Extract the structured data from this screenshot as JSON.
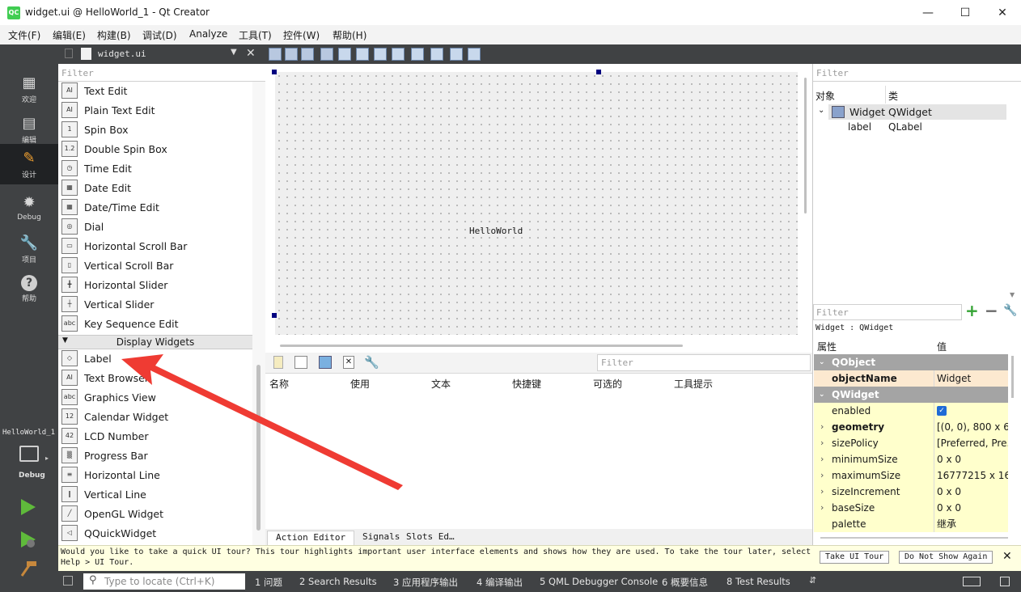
{
  "window": {
    "title": "widget.ui @ HelloWorld_1 - Qt Creator",
    "app_icon": "QC"
  },
  "menu": [
    "文件(F)",
    "编辑(E)",
    "构建(B)",
    "调试(D)",
    "Analyze",
    "工具(T)",
    "控件(W)",
    "帮助(H)"
  ],
  "modes": [
    {
      "label": "欢迎",
      "icon": "grid-icon"
    },
    {
      "label": "编辑",
      "icon": "edit-doc-icon"
    },
    {
      "label": "设计",
      "icon": "pencil-icon"
    },
    {
      "label": "Debug",
      "icon": "bug-icon"
    },
    {
      "label": "项目",
      "icon": "wrench-icon"
    },
    {
      "label": "帮助",
      "icon": "help-icon"
    }
  ],
  "kit": {
    "project": "HelloWorld_1",
    "config": "Debug"
  },
  "editor_tab": {
    "file": "widget.ui"
  },
  "widget_box": {
    "filter_placeholder": "Filter",
    "items_input": [
      {
        "label": "Text Edit",
        "icon": "AI"
      },
      {
        "label": "Plain Text Edit",
        "icon": "AI"
      },
      {
        "label": "Spin Box",
        "icon": "1"
      },
      {
        "label": "Double Spin Box",
        "icon": "1.2"
      },
      {
        "label": "Time Edit",
        "icon": "clock"
      },
      {
        "label": "Date Edit",
        "icon": "cal"
      },
      {
        "label": "Date/Time Edit",
        "icon": "cal"
      },
      {
        "label": "Dial",
        "icon": "dial"
      },
      {
        "label": "Horizontal Scroll Bar",
        "icon": "hsb"
      },
      {
        "label": "Vertical Scroll Bar",
        "icon": "vsb"
      },
      {
        "label": "Horizontal Slider",
        "icon": "hsl"
      },
      {
        "label": "Vertical Slider",
        "icon": "vsl"
      },
      {
        "label": "Key Sequence Edit",
        "icon": "ABC"
      }
    ],
    "category": "Display Widgets",
    "items_display": [
      {
        "label": "Label",
        "icon": "tag"
      },
      {
        "label": "Text Browser",
        "icon": "AI"
      },
      {
        "label": "Graphics View",
        "icon": "abc"
      },
      {
        "label": "Calendar Widget",
        "icon": "12"
      },
      {
        "label": "LCD Number",
        "icon": "42"
      },
      {
        "label": "Progress Bar",
        "icon": "prog"
      },
      {
        "label": "Horizontal Line",
        "icon": "hline"
      },
      {
        "label": "Vertical Line",
        "icon": "vline"
      },
      {
        "label": "OpenGL Widget",
        "icon": "gl"
      },
      {
        "label": "QQuickWidget",
        "icon": "qq"
      }
    ]
  },
  "form": {
    "label_text": "HelloWorld"
  },
  "action_editor": {
    "filter_placeholder": "Filter",
    "columns": [
      "名称",
      "使用",
      "文本",
      "快捷键",
      "可选的",
      "工具提示"
    ],
    "tabs": [
      "Action Editor",
      "Signals",
      "Slots Ed…"
    ]
  },
  "object_inspector": {
    "filter_placeholder": "Filter",
    "headers": [
      "对象",
      "类"
    ],
    "rows": [
      {
        "object": "Widget",
        "class": "QWidget"
      },
      {
        "object": "label",
        "class": "QLabel"
      }
    ]
  },
  "property_editor": {
    "filter_placeholder": "Filter",
    "context": "Widget : QWidget",
    "headers": [
      "属性",
      "值"
    ],
    "rows": [
      {
        "name": "QObject",
        "value": "",
        "kind": "cat"
      },
      {
        "name": "objectName",
        "value": "Widget",
        "kind": "org"
      },
      {
        "name": "QWidget",
        "value": "",
        "kind": "cat"
      },
      {
        "name": "enabled",
        "value": "",
        "kind": "ylw"
      },
      {
        "name": "geometry",
        "value": "[(0, 0), 800 x 6...",
        "kind": "ylw"
      },
      {
        "name": "sizePolicy",
        "value": "[Preferred, Pre...",
        "kind": "ylw"
      },
      {
        "name": "minimumSize",
        "value": "0 x 0",
        "kind": "ylw"
      },
      {
        "name": "maximumSize",
        "value": "16777215 x 16...",
        "kind": "ylw"
      },
      {
        "name": "sizeIncrement",
        "value": "0 x 0",
        "kind": "ylw"
      },
      {
        "name": "baseSize",
        "value": "0 x 0",
        "kind": "ylw"
      },
      {
        "name": "palette",
        "value": "继承",
        "kind": "ylw"
      }
    ]
  },
  "tour": {
    "text": "Would you like to take a quick UI tour? This tour highlights important user interface elements and shows how they are used. To take the tour later, select Help > UI Tour.",
    "take_button": "Take UI Tour",
    "dismiss_button": "Do Not Show Again"
  },
  "statusbar": {
    "locator_placeholder": "Type to locate (Ctrl+K)",
    "panes": [
      "1 问题",
      "2 Search Results",
      "3 应用程序输出",
      "4 编译输出",
      "5 QML Debugger Console",
      "6 概要信息",
      "8 Test Results"
    ]
  },
  "colors": {
    "accent": "#41cd52",
    "dark_panel": "#404244",
    "selection": "#e6e6e6",
    "annotation_arrow": "#ef3b33"
  }
}
